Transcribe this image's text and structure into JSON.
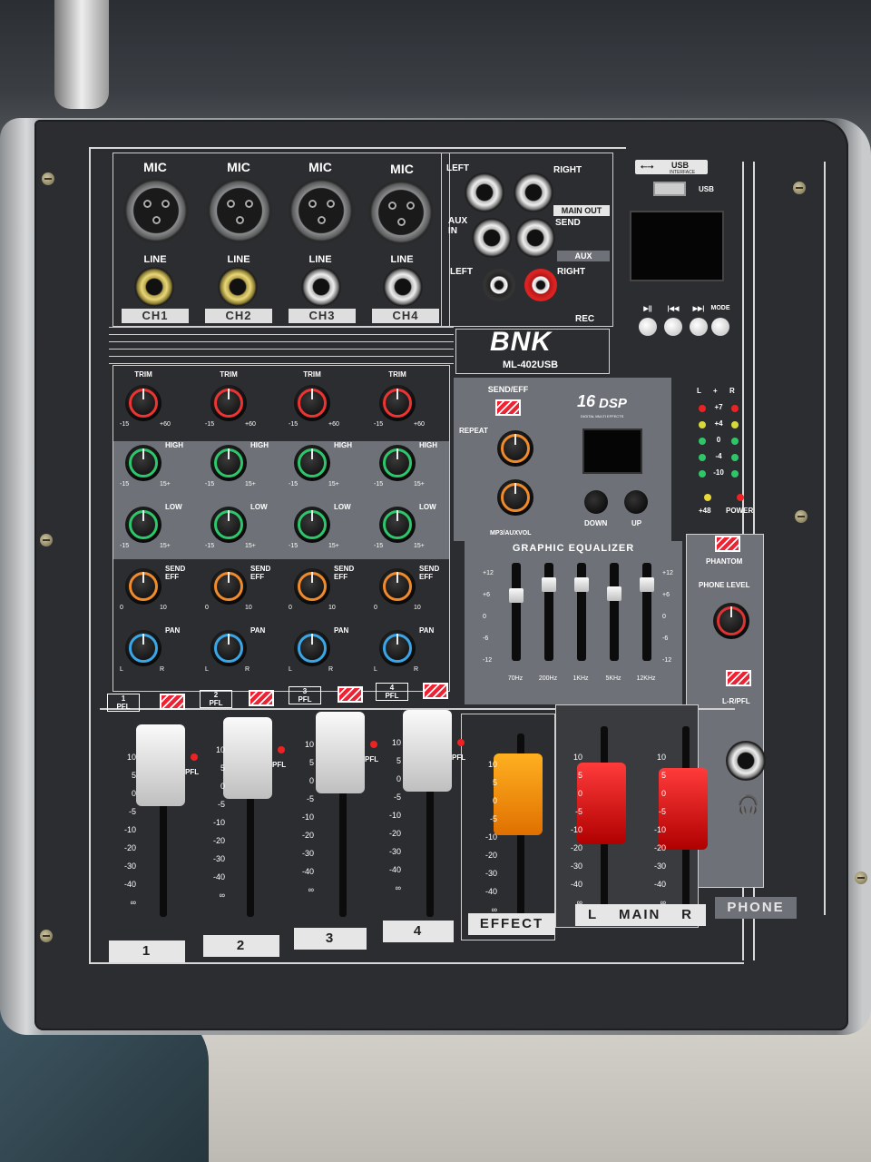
{
  "brand": {
    "name": "BNK",
    "model": "ML-402USB"
  },
  "usb": {
    "badge": "USB",
    "badge_sub": "INTERFACE",
    "port_label": "USB"
  },
  "channels": [
    {
      "number": "1",
      "ch_label": "CH1",
      "jack": "gold"
    },
    {
      "number": "2",
      "ch_label": "CH2",
      "jack": "gold"
    },
    {
      "number": "3",
      "ch_label": "CH3",
      "jack": "silver"
    },
    {
      "number": "4",
      "ch_label": "CH4",
      "jack": "silver"
    }
  ],
  "channel_labels": {
    "mic": "MIC",
    "line": "LINE",
    "trim": "TRIM",
    "high": "HIGH",
    "low": "LOW",
    "send_eff": "SEND\nEFF",
    "pan": "PAN",
    "pfl": "PFL",
    "trim_min": "-15",
    "trim_max": "+60",
    "eq_min": "-15",
    "eq_max": "15+",
    "send_min": "0",
    "send_max": "10",
    "pan_l": "L",
    "pan_r": "R"
  },
  "outputs": {
    "left": "LEFT",
    "right": "RIGHT",
    "main_out": "MAIN OUT",
    "aux_in": "AUX\nIN",
    "send": "SEND",
    "aux": "AUX",
    "rec": "REC"
  },
  "player": {
    "play": "▶||",
    "prev": "|◀◀",
    "next": "▶▶|",
    "mode": "MODE"
  },
  "effects": {
    "send_eff": "SEND/EFF",
    "repeat": "REPEAT",
    "mp3_vol": "MP3/AUXVOL",
    "dsp_num": "16",
    "dsp_word": "DSP",
    "dsp_sub": "DIGITAL MULTI EFFECTS",
    "down": "DOWN",
    "up": "UP"
  },
  "meter": {
    "l": "L",
    "plus": "+",
    "r": "R",
    "levels": [
      "+7",
      "+4",
      "0",
      "-4",
      "-10"
    ],
    "plus48": "+48",
    "power": "POWER"
  },
  "geq": {
    "title": "GRAPHIC EQUALIZER",
    "scale": [
      "+12",
      "+6",
      "0",
      "-6",
      "-12"
    ],
    "bands": [
      "70Hz",
      "200Hz",
      "1KHz",
      "5KHz",
      "12KHz"
    ]
  },
  "phones": {
    "phantom": "PHANTOM",
    "phone_level": "PHONE LEVEL",
    "lr_pfl": "L-R/PFL",
    "label": "PHONE",
    "headphone_glyph": "🎧"
  },
  "fader_scale": [
    "10",
    "5",
    "0",
    "-5",
    "-10",
    "-20",
    "-30",
    "-40",
    "∞"
  ],
  "bottom_labels": {
    "effect": "EFFECT",
    "main_l": "L",
    "main": "MAIN",
    "main_r": "R"
  }
}
